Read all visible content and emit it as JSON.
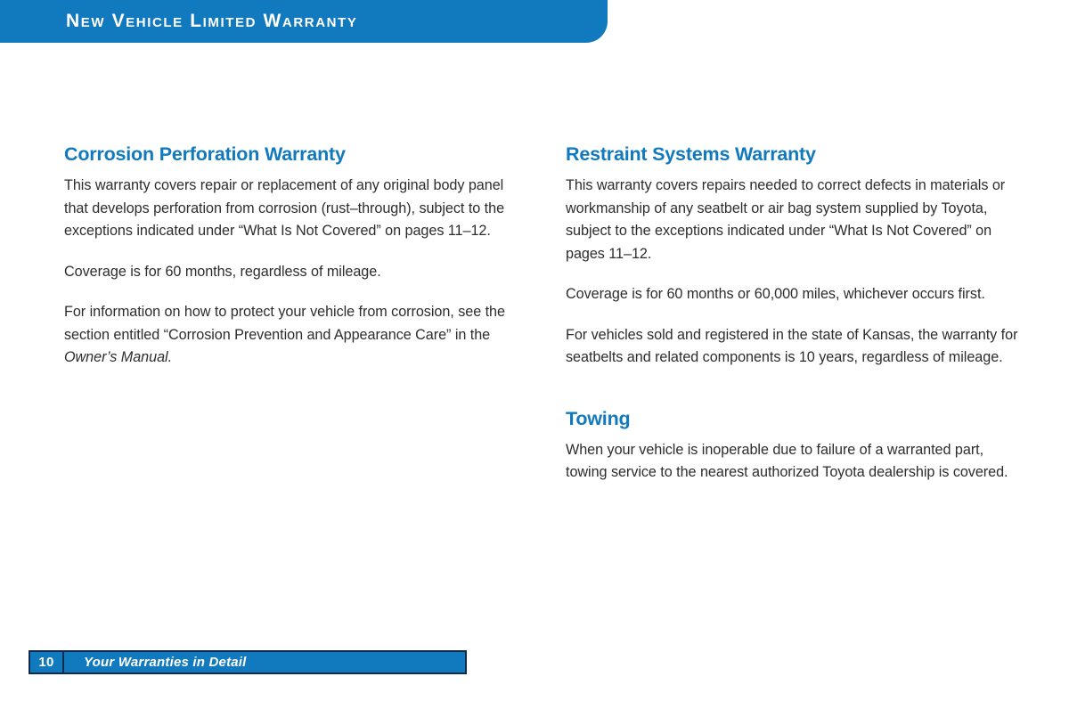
{
  "header": {
    "title": "New Vehicle Limited Warranty",
    "background_color": "#1179bd",
    "text_color": "#ffffff"
  },
  "theme": {
    "heading_color": "#1179bd",
    "body_text_color": "#2d2d2d",
    "page_background": "#ffffff",
    "footer_border_color": "#0e2b4c"
  },
  "columns": {
    "left": {
      "sections": [
        {
          "heading": "Corrosion Perforation Warranty",
          "paragraphs": [
            "This warranty covers repair or replacement of any original body panel that develops perforation from corrosion (rust–through), subject to the exceptions indicated under “What Is Not Covered” on pages 11–12.",
            "Coverage is for 60 months, regardless of mileage.",
            "For information on how to protect your vehicle from corrosion, see the section entitled “Corrosion Prevention and Appearance Care” in the "
          ],
          "italic_tail": "Owner’s Manual."
        }
      ]
    },
    "right": {
      "sections": [
        {
          "heading": "Restraint Systems Warranty",
          "paragraphs": [
            "This warranty covers repairs needed to correct defects in materials or workmanship of any seatbelt or air bag system supplied by Toyota, subject to the exceptions indicated under “What Is Not Covered” on pages 11–12.",
            "Coverage is for 60 months or 60,000 miles, whichever occurs first.",
            "For vehicles sold and registered in the state of Kansas, the warranty for seatbelts and related components is 10 years, regardless of mileage."
          ]
        },
        {
          "heading": "Towing",
          "paragraphs": [
            "When your vehicle is inoperable due to failure of a warranted part, towing service to the nearest authorized Toyota dealership is covered."
          ]
        }
      ]
    }
  },
  "footer": {
    "page_number": "10",
    "label": "Your Warranties in Detail"
  }
}
